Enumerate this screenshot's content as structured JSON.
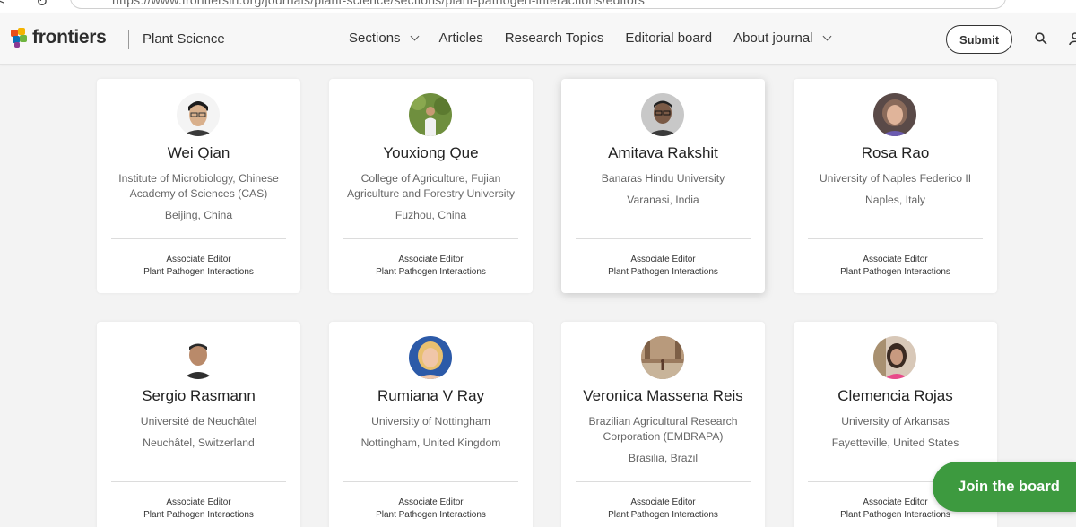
{
  "browser": {
    "url": "https://www.frontiersin.org/journals/plant-science/sections/plant-pathogen-interactions/editors"
  },
  "header": {
    "logo_text": "frontiers",
    "journal": "Plant Science",
    "nav": [
      {
        "label": "Sections",
        "has_dropdown": true
      },
      {
        "label": "Articles",
        "has_dropdown": false
      },
      {
        "label": "Research Topics",
        "has_dropdown": false
      },
      {
        "label": "Editorial board",
        "has_dropdown": false
      },
      {
        "label": "About journal",
        "has_dropdown": true
      }
    ],
    "submit_label": "Submit"
  },
  "editors": [
    {
      "name": "Wei Qian",
      "institution": "Institute of Microbiology, Chinese Academy of Sciences (CAS)",
      "location": "Beijing, China",
      "role": "Associate Editor",
      "section": "Plant Pathogen Interactions"
    },
    {
      "name": "Youxiong Que",
      "institution": "College of Agriculture, Fujian Agriculture and Forestry University",
      "location": "Fuzhou, China",
      "role": "Associate Editor",
      "section": "Plant Pathogen Interactions"
    },
    {
      "name": "Amitava Rakshit",
      "institution": "Banaras Hindu University",
      "location": "Varanasi, India",
      "role": "Associate Editor",
      "section": "Plant Pathogen Interactions"
    },
    {
      "name": "Rosa Rao",
      "institution": "University of Naples Federico II",
      "location": "Naples, Italy",
      "role": "Associate Editor",
      "section": "Plant Pathogen Interactions"
    },
    {
      "name": "Sergio Rasmann",
      "institution": "Université de Neuchâtel",
      "location": "Neuchâtel, Switzerland",
      "role": "Associate Editor",
      "section": "Plant Pathogen Interactions"
    },
    {
      "name": "Rumiana V Ray",
      "institution": "University of Nottingham",
      "location": "Nottingham, United Kingdom",
      "role": "Associate Editor",
      "section": "Plant Pathogen Interactions"
    },
    {
      "name": "Veronica Massena Reis",
      "institution": "Brazilian Agricultural Research Corporation (EMBRAPA)",
      "location": "Brasilia, Brazil",
      "role": "Associate Editor",
      "section": "Plant Pathogen Interactions"
    },
    {
      "name": "Clemencia Rojas",
      "institution": "University of Arkansas",
      "location": "Fayetteville, United States",
      "role": "Associate Editor",
      "section": "Plant Pathogen Interactions"
    }
  ],
  "join_label": "Join the board",
  "colors": {
    "accent": "#3d9a3f"
  }
}
